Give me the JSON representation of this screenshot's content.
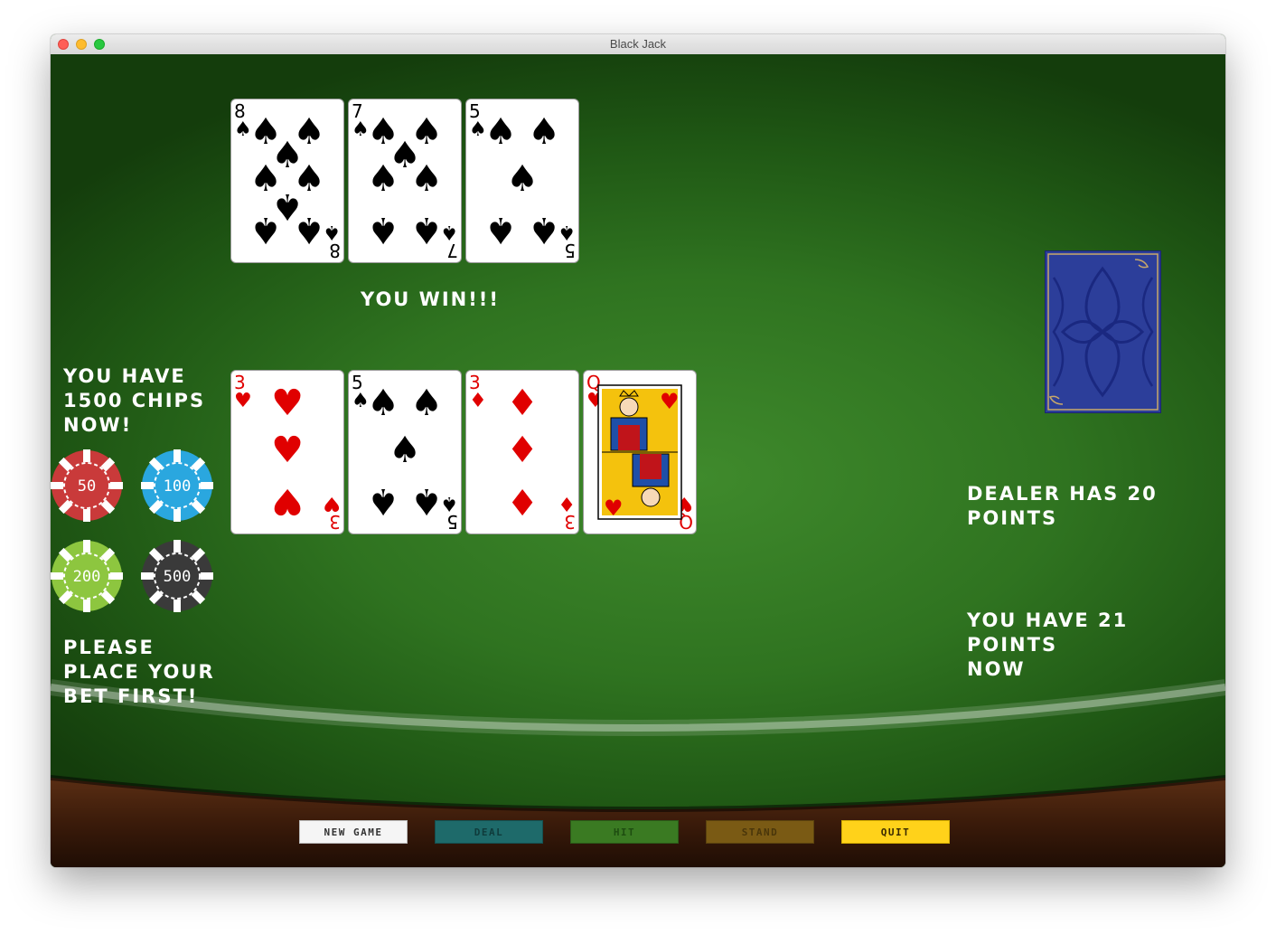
{
  "window": {
    "title": "Black Jack"
  },
  "dealer_cards": [
    {
      "rank": "8",
      "suit": "spades"
    },
    {
      "rank": "7",
      "suit": "spades"
    },
    {
      "rank": "5",
      "suit": "spades"
    }
  ],
  "player_cards": [
    {
      "rank": "3",
      "suit": "hearts"
    },
    {
      "rank": "5",
      "suit": "spades"
    },
    {
      "rank": "3",
      "suit": "diamonds"
    },
    {
      "rank": "Q",
      "suit": "hearts"
    }
  ],
  "result_message": "YOU WIN!!!",
  "chips_message": [
    "YOU HAVE",
    "1500 CHIPS",
    "NOW!"
  ],
  "chips": [
    {
      "value": "50",
      "color": "#c93a3a"
    },
    {
      "value": "100",
      "color": "#2aa7df"
    },
    {
      "value": "200",
      "color": "#8dc63f"
    },
    {
      "value": "500",
      "color": "#3a3a3a"
    }
  ],
  "bet_message": [
    "PLEASE",
    "PLACE YOUR",
    "BET FIRST!"
  ],
  "dealer_points_message": [
    "DEALER HAS 20",
    "POINTS"
  ],
  "player_points_message": [
    "YOU HAVE 21 POINTS",
    "NOW"
  ],
  "buttons": {
    "new_game": "NEW GAME",
    "deal": "DEAL",
    "hit": "HIT",
    "stand": "STAND",
    "quit": "QUIT"
  },
  "colors": {
    "felt": "#2f7320",
    "deck_back": "#2c3e9a",
    "deck_trim": "#c8a86a",
    "btn_new_game": "#f5f5f5",
    "btn_deal": "#1e6a6a",
    "btn_hit": "#3a7a22",
    "btn_stand": "#7a5a14",
    "btn_quit": "#ffd21a"
  }
}
